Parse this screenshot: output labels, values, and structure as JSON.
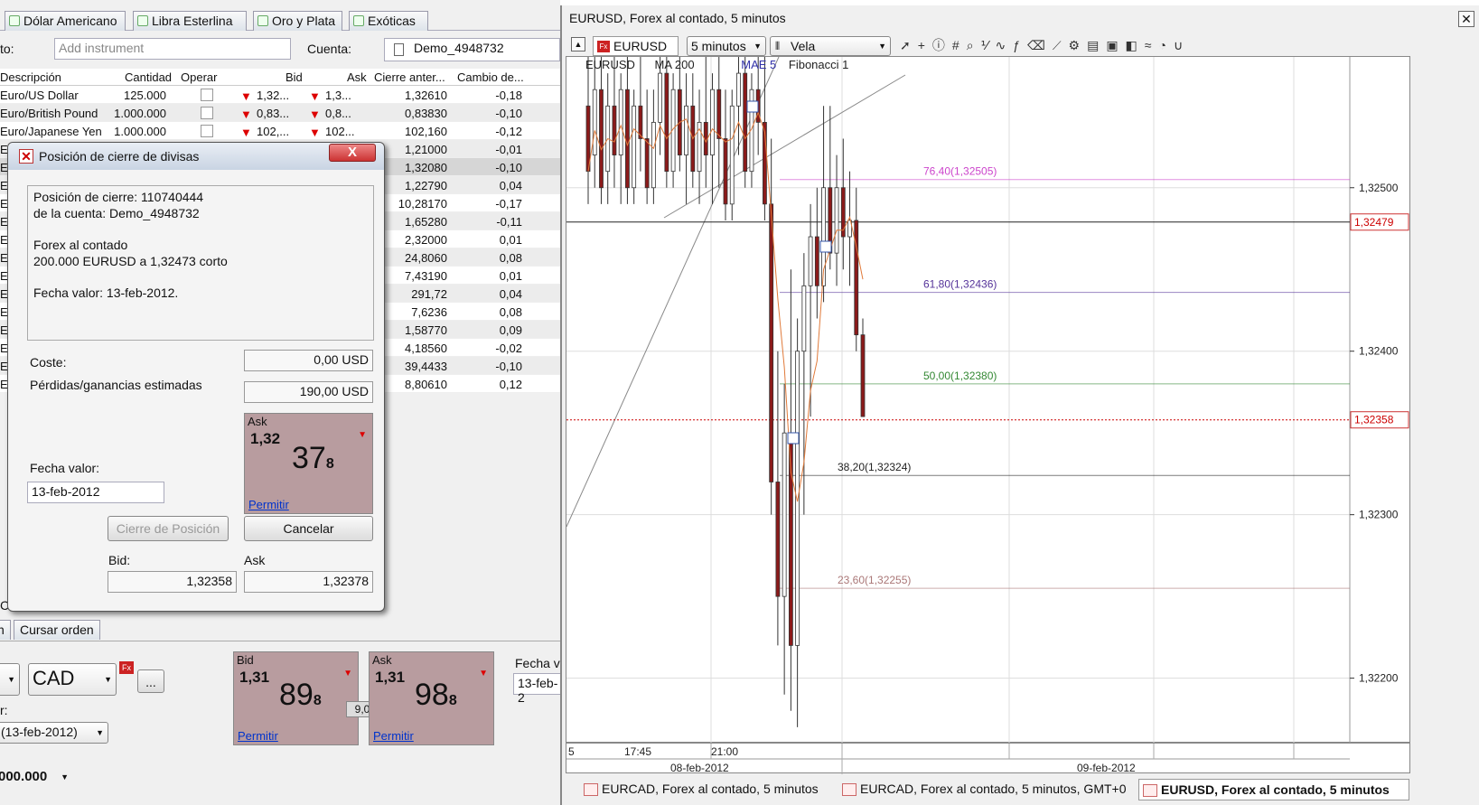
{
  "left_panel": {
    "tabs": [
      "Dólar Americano",
      "Libra Esterlina",
      "Oro y Plata",
      "Exóticas"
    ],
    "instrument_label": "to:",
    "instrument_placeholder": "Add instrument",
    "account_label": "Cuenta:",
    "account_value": "Demo_4948732",
    "columns": [
      "Descripción",
      "Cantidad",
      "Operar",
      "Bid",
      "Ask",
      "Cierre anter...",
      "Cambio de..."
    ],
    "rows": [
      {
        "desc": "Euro/US Dollar",
        "qty": "125.000",
        "bid": "1,32...",
        "ask": "1,3...",
        "close": "1,32610",
        "chg": "-0,18"
      },
      {
        "desc": "Euro/British Pound",
        "qty": "1.000.000",
        "bid": "0,83...",
        "ask": "0,8...",
        "close": "0,83830",
        "chg": "-0,10"
      },
      {
        "desc": "Euro/Japanese Yen",
        "qty": "1.000.000",
        "bid": "102,...",
        "ask": "102...",
        "close": "102,160",
        "chg": "-0,12"
      },
      {
        "desc": "Eu",
        "close": "1,21000",
        "chg": "-0,01"
      },
      {
        "desc": "Eu",
        "close": "1,32080",
        "chg": "-0,10"
      },
      {
        "desc": "Eu",
        "close": "1,22790",
        "chg": "0,04"
      },
      {
        "desc": "Eu",
        "close": "10,28170",
        "chg": "-0,17"
      },
      {
        "desc": "Eu",
        "close": "1,65280",
        "chg": "-0,11"
      },
      {
        "desc": "Eu",
        "close": "2,32000",
        "chg": "0,01"
      },
      {
        "desc": "Eu",
        "close": "24,8060",
        "chg": "0,08"
      },
      {
        "desc": "Eu",
        "close": "7,43190",
        "chg": "0,01"
      },
      {
        "desc": "Eu",
        "close": "291,72",
        "chg": "0,04"
      },
      {
        "desc": "Eu",
        "close": "7,6236",
        "chg": "0,08"
      },
      {
        "desc": "Eu",
        "close": "1,58770",
        "chg": "0,09"
      },
      {
        "desc": "Eu",
        "close": "4,18560",
        "chg": "-0,02"
      },
      {
        "desc": "Eu",
        "close": "39,4433",
        "chg": "-0,10"
      },
      {
        "desc": "Eu",
        "close": "8,80610",
        "chg": "0,12"
      }
    ],
    "order_tabs": [
      "n",
      "Cursar orden"
    ],
    "currency": "CAD",
    "fx_badge": "Fx",
    "ellipsis": "...",
    "date_label": "r:",
    "date_select": "(13-feb-2012)",
    "amount_select": "000.000",
    "fecha_label": "Fecha v",
    "fecha_value": "13-feb-2",
    "spread": "9,0",
    "bid_quote": {
      "label": "Bid",
      "big": "1,31",
      "pips": "89",
      "frac": "8",
      "link": "Permitir"
    },
    "ask_quote": {
      "label": "Ask",
      "big": "1,31",
      "pips": "98",
      "frac": "8",
      "link": "Permitir"
    },
    "ca_label": "CA"
  },
  "dialog": {
    "title": "Posición de cierre de divisas",
    "close_label": "X",
    "info_lines": [
      "Posición de cierre: 110740444",
      "de la cuenta: Demo_4948732",
      "Forex al contado",
      "200.000 EURUSD a 1,32473 corto",
      "Fecha valor: 13-feb-2012."
    ],
    "cost_label": "Coste:",
    "cost_value": "0,00 USD",
    "pl_label": "Pérdidas/ganancias estimadas",
    "pl_value": "190,00 USD",
    "ask_quote": {
      "label": "Ask",
      "big": "1,32",
      "pips": "37",
      "frac": "8",
      "link": "Permitir"
    },
    "value_date_label": "Fecha valor:",
    "value_date": "13-feb-2012",
    "close_btn": "Cierre de Posición",
    "cancel_btn": "Cancelar",
    "bid_label": "Bid:",
    "bid_value": "1,32358",
    "ask_label": "Ask",
    "ask_value": "1,32378"
  },
  "chart_window": {
    "title": "EURUSD, Forex al contado, 5 minutos",
    "symbol": "EURUSD",
    "symbol_badge": "Fx",
    "interval": "5 minutos",
    "chart_style": "Vela",
    "indicators": [
      "EURUSD",
      "MA 200",
      "MAE 5",
      "Fibonacci 1"
    ],
    "bottom_tabs": [
      "EURCAD, Forex al contado, 5 minutos",
      "EURCAD, Forex al contado, 5 minutos, GMT+0",
      "EURUSD, Forex al contado, 5 minutos"
    ],
    "close_icon": "close-icon"
  },
  "chart_data": {
    "type": "candlestick",
    "symbol": "EURUSD",
    "interval": "5 minutos",
    "ylim": [
      1.3216,
      1.3258
    ],
    "y_ticks": [
      "1,32500",
      "1,32400",
      "1,32300",
      "1,32200"
    ],
    "y_tick_values": [
      1.325,
      1.324,
      1.323,
      1.322
    ],
    "x_time_labels": [
      "5",
      "17:45",
      "21:00"
    ],
    "x_date_labels": [
      "08-feb-2012",
      "09-feb-2012"
    ],
    "price_markers": [
      {
        "label": "1,32479",
        "value": 1.32479,
        "style": "solid-black"
      },
      {
        "label": "1,32358",
        "value": 1.32358,
        "style": "dotted-red"
      }
    ],
    "fibonacci_levels": [
      {
        "label": "76,40(1,32505)",
        "value": 1.32505,
        "color": "#cc44cc"
      },
      {
        "label": "61,80(1,32436)",
        "value": 1.32436,
        "color": "#553399"
      },
      {
        "label": "50,00(1,32380)",
        "value": 1.3238,
        "color": "#338833"
      },
      {
        "label": "38,20(1,32324)",
        "value": 1.32324,
        "color": "#222222"
      },
      {
        "label": "23,60(1,32255)",
        "value": 1.32255,
        "color": "#aa7777"
      }
    ],
    "candles": [
      {
        "o": 1.3255,
        "h": 1.3258,
        "l": 1.3249,
        "c": 1.3251
      },
      {
        "o": 1.3252,
        "h": 1.3258,
        "l": 1.325,
        "c": 1.3256
      },
      {
        "o": 1.3256,
        "h": 1.3258,
        "l": 1.3249,
        "c": 1.325
      },
      {
        "o": 1.3251,
        "h": 1.3257,
        "l": 1.3249,
        "c": 1.3255
      },
      {
        "o": 1.3255,
        "h": 1.3258,
        "l": 1.325,
        "c": 1.3252
      },
      {
        "o": 1.3252,
        "h": 1.3257,
        "l": 1.3249,
        "c": 1.3256
      },
      {
        "o": 1.3256,
        "h": 1.3258,
        "l": 1.3249,
        "c": 1.325
      },
      {
        "o": 1.325,
        "h": 1.3256,
        "l": 1.3249,
        "c": 1.3255
      },
      {
        "o": 1.3255,
        "h": 1.3258,
        "l": 1.3251,
        "c": 1.3253
      },
      {
        "o": 1.3253,
        "h": 1.3256,
        "l": 1.3249,
        "c": 1.325
      },
      {
        "o": 1.325,
        "h": 1.3256,
        "l": 1.3249,
        "c": 1.3254
      },
      {
        "o": 1.3254,
        "h": 1.3258,
        "l": 1.3252,
        "c": 1.3257
      },
      {
        "o": 1.3257,
        "h": 1.3258,
        "l": 1.325,
        "c": 1.3251
      },
      {
        "o": 1.3251,
        "h": 1.3257,
        "l": 1.325,
        "c": 1.3256
      },
      {
        "o": 1.3256,
        "h": 1.3258,
        "l": 1.3251,
        "c": 1.3252
      },
      {
        "o": 1.3252,
        "h": 1.3257,
        "l": 1.3249,
        "c": 1.3255
      },
      {
        "o": 1.3255,
        "h": 1.3257,
        "l": 1.325,
        "c": 1.3251
      },
      {
        "o": 1.3251,
        "h": 1.3256,
        "l": 1.3249,
        "c": 1.3254
      },
      {
        "o": 1.3254,
        "h": 1.3258,
        "l": 1.325,
        "c": 1.3252
      },
      {
        "o": 1.3252,
        "h": 1.3257,
        "l": 1.3249,
        "c": 1.3256
      },
      {
        "o": 1.3256,
        "h": 1.3258,
        "l": 1.325,
        "c": 1.3253
      },
      {
        "o": 1.3253,
        "h": 1.3256,
        "l": 1.3248,
        "c": 1.3249
      },
      {
        "o": 1.3249,
        "h": 1.3256,
        "l": 1.3248,
        "c": 1.3255
      },
      {
        "o": 1.3255,
        "h": 1.3258,
        "l": 1.3252,
        "c": 1.3257
      },
      {
        "o": 1.3257,
        "h": 1.3258,
        "l": 1.325,
        "c": 1.3251
      },
      {
        "o": 1.3251,
        "h": 1.3257,
        "l": 1.325,
        "c": 1.3256
      },
      {
        "o": 1.3256,
        "h": 1.3258,
        "l": 1.3252,
        "c": 1.3254
      },
      {
        "o": 1.3254,
        "h": 1.3258,
        "l": 1.3248,
        "c": 1.3249
      },
      {
        "o": 1.3249,
        "h": 1.3253,
        "l": 1.323,
        "c": 1.3232
      },
      {
        "o": 1.3232,
        "h": 1.324,
        "l": 1.3222,
        "c": 1.3225
      },
      {
        "o": 1.3225,
        "h": 1.3238,
        "l": 1.3219,
        "c": 1.3235
      },
      {
        "o": 1.3235,
        "h": 1.3245,
        "l": 1.3218,
        "c": 1.3222
      },
      {
        "o": 1.3222,
        "h": 1.3242,
        "l": 1.3217,
        "c": 1.324
      },
      {
        "o": 1.324,
        "h": 1.3246,
        "l": 1.323,
        "c": 1.3244
      },
      {
        "o": 1.3244,
        "h": 1.3249,
        "l": 1.3236,
        "c": 1.3247
      },
      {
        "o": 1.3247,
        "h": 1.325,
        "l": 1.3242,
        "c": 1.3244
      },
      {
        "o": 1.3244,
        "h": 1.3255,
        "l": 1.3243,
        "c": 1.325
      },
      {
        "o": 1.325,
        "h": 1.3255,
        "l": 1.3245,
        "c": 1.3246
      },
      {
        "o": 1.3246,
        "h": 1.3252,
        "l": 1.3244,
        "c": 1.325
      },
      {
        "o": 1.325,
        "h": 1.3253,
        "l": 1.3245,
        "c": 1.3247
      },
      {
        "o": 1.3247,
        "h": 1.3251,
        "l": 1.3244,
        "c": 1.3248
      },
      {
        "o": 1.3248,
        "h": 1.325,
        "l": 1.324,
        "c": 1.3241
      },
      {
        "o": 1.3241,
        "h": 1.3242,
        "l": 1.3236,
        "c": 1.3236
      }
    ]
  }
}
